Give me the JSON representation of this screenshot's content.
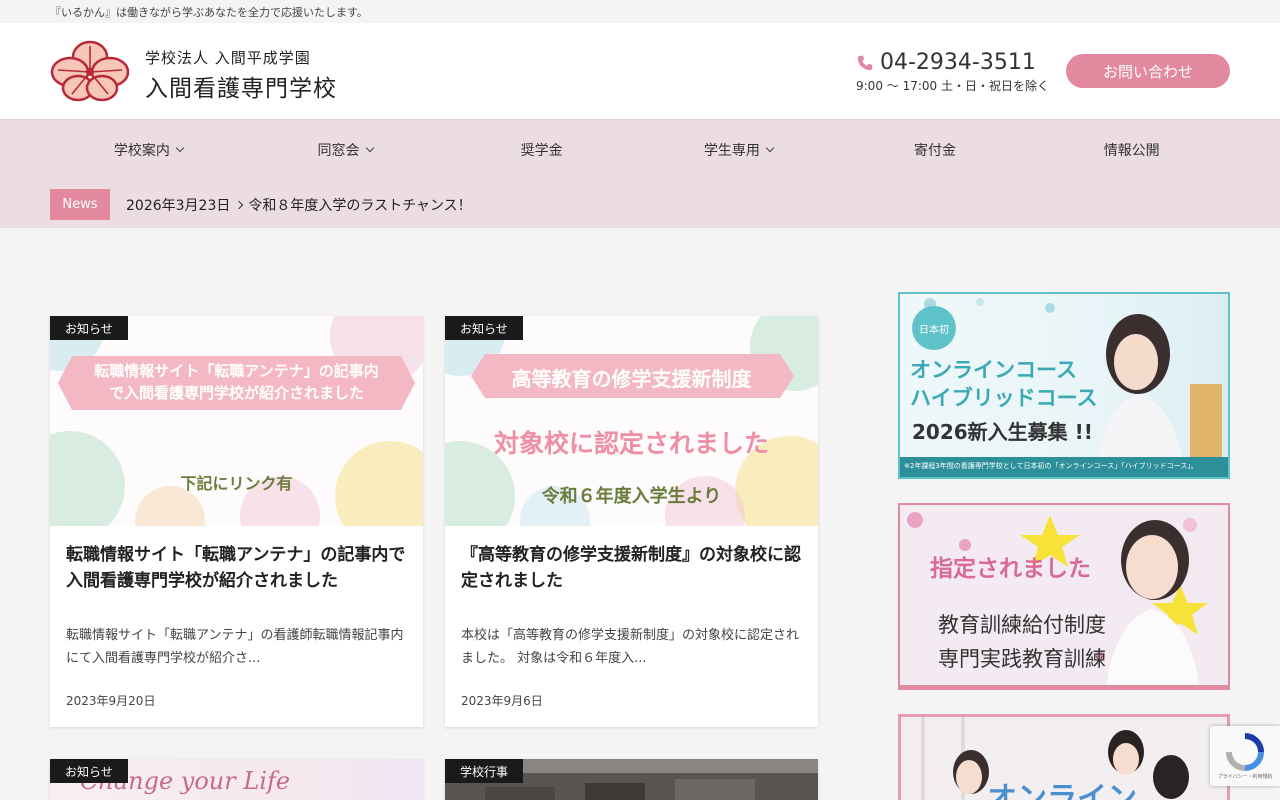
{
  "topbar": {
    "tagline": "『いるかん』は働きながら学ぶあなたを全力で応援いたします。"
  },
  "header": {
    "org": "学校法人 入間平成学園",
    "school": "入間看護専門学校",
    "phone": "04-2934-3511",
    "hours": "9:00 〜 17:00 土・日・祝日を除く",
    "contact_label": "お問い合わせ",
    "icons": {
      "phone": "phone-icon",
      "logo": "flower-logo"
    },
    "colors": {
      "accent": "#e2889f",
      "nav_bg": "#ecdde2",
      "logo_red": "#b8293a"
    }
  },
  "nav": {
    "items": [
      {
        "label": "学校案内",
        "dropdown": true
      },
      {
        "label": "同窓会",
        "dropdown": true
      },
      {
        "label": "奨学金",
        "dropdown": false
      },
      {
        "label": "学生専用",
        "dropdown": true
      },
      {
        "label": "寄付金",
        "dropdown": false
      },
      {
        "label": "情報公開",
        "dropdown": false
      }
    ]
  },
  "news": {
    "badge": "News",
    "date": "2026年3月23日",
    "title": "令和８年度入学のラストチャンス！"
  },
  "posts": [
    {
      "category": "お知らせ",
      "thumb_banner": "転職情報サイト「転職アンテナ」の記事内で入間看護専門学校が紹介されました",
      "thumb_sub": "下記にリンク有",
      "title": "転職情報サイト「転職アンテナ」の記事内で入間看護専門学校が紹介されました",
      "excerpt": "転職情報サイト「転職アンテナ」の看護師転職情報記事内にて入間看護専門学校が紹介さ...",
      "date": "2023年9月20日"
    },
    {
      "category": "お知らせ",
      "thumb_banner": "高等教育の修学支援新制度",
      "thumb_main": "対象校に認定されました",
      "thumb_sub": "令和６年度入学生より",
      "title": "『高等教育の修学支援新制度』の対象校に認定されました",
      "excerpt": "本校は「高等教育の修学支援新制度」の対象校に認定されました。 対象は令和６年度入...",
      "date": "2023年9月6日"
    },
    {
      "category": "お知らせ",
      "thumb_text": "Change your Life"
    },
    {
      "category": "学校行事"
    }
  ],
  "sidebar": {
    "banner1": {
      "badge": "日本初",
      "line1": "オンラインコース",
      "line2": "ハイブリッドコース",
      "line3": "2026新入生募集 !!",
      "note": "※2年課程3年間の看護専門学校として日本初の「オンラインコース」「ハイブリッドコース」。"
    },
    "banner2": {
      "line1": "指定されました",
      "line2": "教育訓練給付制度",
      "line3": "専門実践教育訓練"
    },
    "banner3": {
      "line1": "オンライン"
    }
  },
  "recaptcha": {
    "label": "プライバシー・利用規約"
  }
}
